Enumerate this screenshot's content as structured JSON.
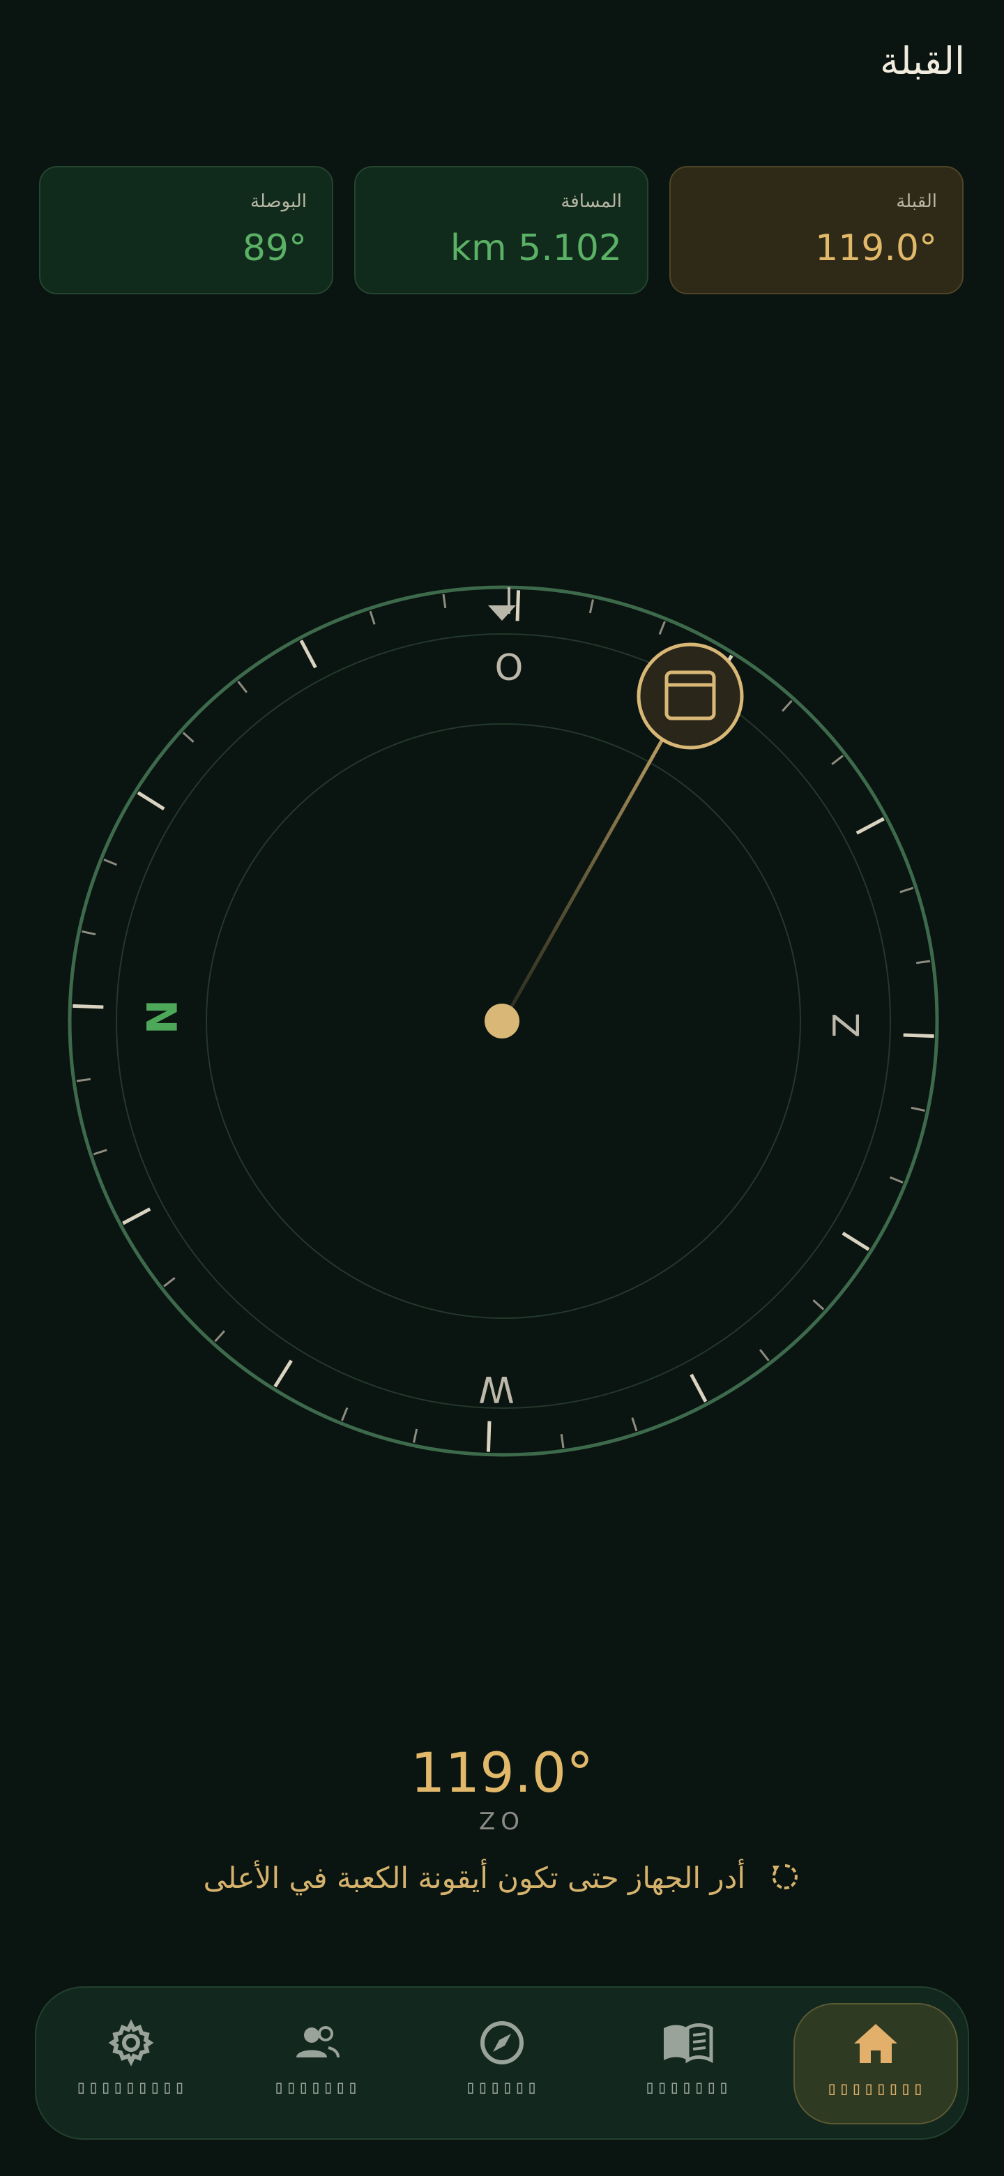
{
  "header": {
    "title": "القبلة"
  },
  "cards": {
    "compass": {
      "label": "البوصلة",
      "value": "89°"
    },
    "distance": {
      "label": "المسافة",
      "value": "km 5.102"
    },
    "qibla": {
      "label": "القبلة",
      "value": "119.0°"
    }
  },
  "compass": {
    "device_heading_deg": 89,
    "qibla_bearing_deg": 119.0,
    "labels": {
      "north": "N",
      "east": "O",
      "south": "Z",
      "west": "W"
    },
    "accent": "#e2b96a",
    "ring_color": "#3e6a4c",
    "north_color": "#4ea85a"
  },
  "reading": {
    "heading": "119.0°",
    "direction": "ZO"
  },
  "hint": {
    "text": "أدر الجهاز حتى تكون أيقونة الكعبة في الأعلى"
  },
  "nav": {
    "items": [
      {
        "icon": "gear-icon",
        "label": "▯▯▯▯▯▯▯▯▯"
      },
      {
        "icon": "people-icon",
        "label": "▯▯▯▯▯▯▯"
      },
      {
        "icon": "compass-icon",
        "label": "▯▯▯▯▯▯"
      },
      {
        "icon": "book-icon",
        "label": "▯▯▯▯▯▯▯"
      },
      {
        "icon": "home-icon",
        "label": "▯▯▯▯▯▯▯▯",
        "active": true
      }
    ]
  },
  "colors": {
    "background": "#0a1411",
    "accent_gold": "#e2b96a",
    "accent_green": "#5bb165"
  }
}
